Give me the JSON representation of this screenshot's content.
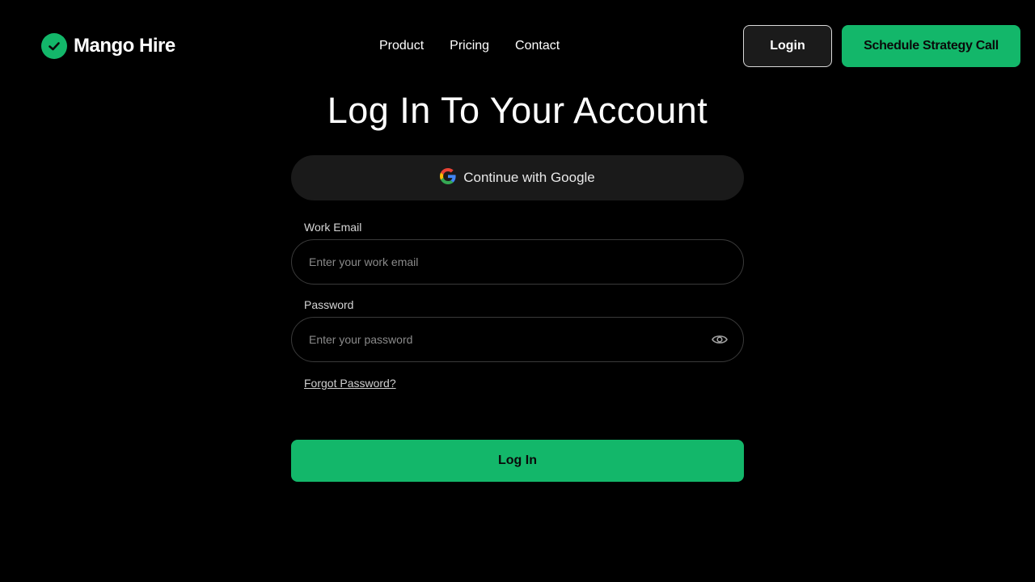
{
  "header": {
    "brand_name": "Mango Hire",
    "nav": {
      "product": "Product",
      "pricing": "Pricing",
      "contact": "Contact"
    },
    "login_label": "Login",
    "schedule_label": "Schedule Strategy Call"
  },
  "form": {
    "title": "Log In To Your Account",
    "google_label": "Continue with Google",
    "email_label": "Work Email",
    "email_placeholder": "Enter your work email",
    "email_value": "",
    "password_label": "Password",
    "password_placeholder": "Enter your password",
    "password_value": "",
    "forgot_label": "Forgot Password?",
    "submit_label": "Log In"
  },
  "icons": {
    "brand": "check-circle-icon",
    "google": "google-icon",
    "password_toggle": "eye-icon"
  },
  "colors": {
    "background": "#000000",
    "accent": "#13b76a",
    "surface": "#1a1a1a",
    "field_border": "#3a3a3a"
  }
}
